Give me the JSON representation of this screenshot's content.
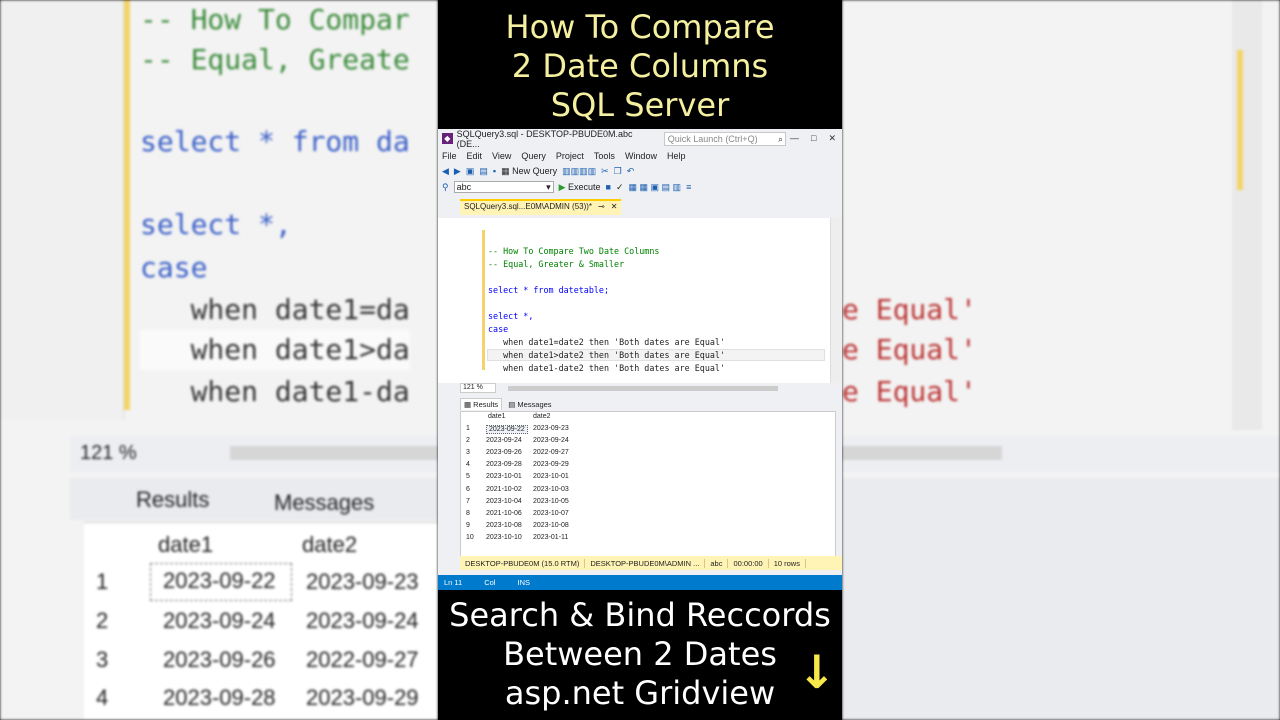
{
  "banner_top": {
    "line1": "How To Compare",
    "line2": "2 Date Columns",
    "line3": "SQL Server"
  },
  "banner_bottom": {
    "line1": "Search & Bind Reccords",
    "line2": "Between 2 Dates",
    "line3": "asp.net Gridview",
    "arrow": "↓"
  },
  "window": {
    "title": "SQLQuery3.sql - DESKTOP-PBUDE0M.abc (DE...",
    "quick_launch_placeholder": "Quick Launch (Ctrl+Q)",
    "search_icon": "⌕",
    "minimize": "—",
    "maximize": "□",
    "close": "✕"
  },
  "menu": [
    "File",
    "Edit",
    "View",
    "Query",
    "Project",
    "Tools",
    "Window",
    "Help"
  ],
  "toolbar": {
    "new_query": "New Query",
    "database": "abc",
    "execute": "Execute"
  },
  "tab": {
    "label": "SQLQuery3.sql...E0M\\ADMIN (53))*",
    "pin": "⊸",
    "close": "✕"
  },
  "code_lines": [
    {
      "text": "-- How To Compare Two Date Columns",
      "cls": "cm"
    },
    {
      "text": "-- Equal, Greater & Smaller",
      "cls": "cm"
    },
    {
      "text": "",
      "cls": "tx"
    },
    {
      "text": "select * from datetable;",
      "cls": "kw"
    },
    {
      "text": "",
      "cls": "tx"
    },
    {
      "text": "select *,",
      "cls": "kw"
    },
    {
      "text": "case",
      "cls": "kw"
    },
    {
      "text": "   when date1=date2 then 'Both dates are Equal'",
      "cls": "tx"
    },
    {
      "text": "   when date1>date2 then 'Both dates are Equal'",
      "cls": "tx"
    },
    {
      "text": "   when date1-date2 then 'Both dates are Equal'",
      "cls": "tx"
    }
  ],
  "zoom": "121 %",
  "results_tab": "Results",
  "messages_tab": "Messages",
  "grid": {
    "columns": [
      "date1",
      "date2"
    ],
    "rows": [
      [
        "1",
        "2023-09-22",
        "2023-09-23"
      ],
      [
        "2",
        "2023-09-24",
        "2023-09-24"
      ],
      [
        "3",
        "2023-09-26",
        "2022-09-27"
      ],
      [
        "4",
        "2023-09-28",
        "2023-09-29"
      ],
      [
        "5",
        "2023-10-01",
        "2023-10-01"
      ],
      [
        "6",
        "2021-10-02",
        "2023-10-03"
      ],
      [
        "7",
        "2023-10-04",
        "2023-10-05"
      ],
      [
        "8",
        "2021-10-06",
        "2023-10-07"
      ],
      [
        "9",
        "2023-10-08",
        "2023-10-08"
      ],
      [
        "10",
        "2023-10-10",
        "2023-01-11"
      ]
    ]
  },
  "query_status": {
    "server": "DESKTOP-PBUDE0M (15.0 RTM)",
    "user": "DESKTOP-PBUDE0M\\ADMIN ...",
    "db": "abc",
    "time": "00:00:00",
    "rows": "10 rows"
  },
  "status": {
    "ln": "Ln 11",
    "col": "Col",
    "ins": "INS"
  },
  "bg": {
    "code1": "-- How To Compar",
    "code2": "-- Equal, Greate",
    "code3": "select * from da",
    "code4": "select *,",
    "code5": "case",
    "code6": "   when date1=da",
    "code7": "   when date1>da",
    "code8": "   when date1-da",
    "zoom": "121 %",
    "results": "Results",
    "messages": "Messages",
    "col1": "date1",
    "col2": "date2",
    "right1": "e Equal'",
    "right2": "e Equal'",
    "right3": "e Equal'"
  }
}
